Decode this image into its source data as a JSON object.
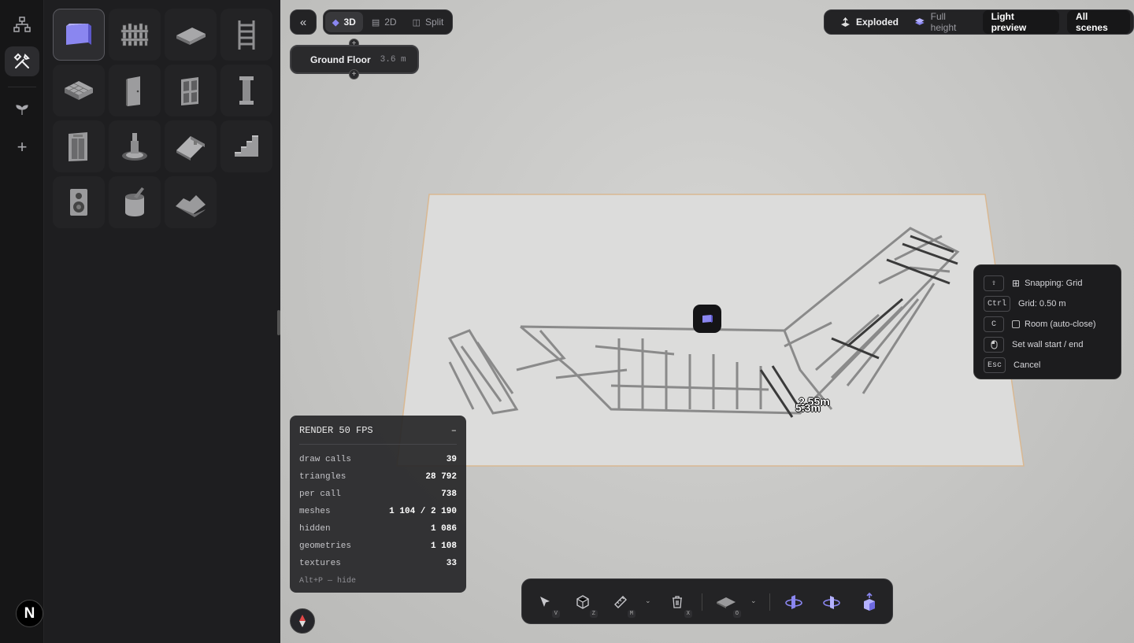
{
  "rail": {
    "items": [
      {
        "name": "hierarchy",
        "glyph": "⛙"
      },
      {
        "name": "build-tools",
        "glyph": "⚒"
      },
      {
        "name": "sprout",
        "glyph": "❦"
      },
      {
        "name": "add",
        "glyph": "+"
      }
    ],
    "logo": "N"
  },
  "catalog": {
    "items": [
      "Wall",
      "Fence",
      "Slab",
      "Ladder",
      "Ceiling",
      "Door",
      "Window",
      "Column",
      "Elevator",
      "Fountain",
      "Roof",
      "Stairs",
      "Speaker",
      "Paint",
      "Terrain"
    ]
  },
  "view": {
    "collapse_glyph": "«",
    "tabs": [
      {
        "label": "3D",
        "glyph": "◆"
      },
      {
        "label": "2D",
        "glyph": "▤"
      },
      {
        "label": "Split",
        "glyph": "◫"
      }
    ]
  },
  "floor": {
    "name": "Ground Floor",
    "height": "3.6 m"
  },
  "display": {
    "exploded_label": "Exploded",
    "full_height_label": "Full height",
    "light_preview_label": "Light preview",
    "all_scenes_label": "All scenes"
  },
  "shortcuts": [
    {
      "key": "⇧",
      "label": "Snapping: Grid",
      "icon": "grid"
    },
    {
      "key": "Ctrl",
      "label": "Grid: 0.50 m",
      "icon": ""
    },
    {
      "key": "C",
      "label": "Room (auto-close)",
      "icon": "checkbox"
    },
    {
      "key": "🖱",
      "label": "Set wall start / end",
      "icon": ""
    },
    {
      "key": "Esc",
      "label": "Cancel",
      "icon": ""
    }
  ],
  "stats": {
    "title": "RENDER 50 FPS",
    "collapse": "–",
    "rows": [
      {
        "k": "draw calls",
        "v": "39"
      },
      {
        "k": "triangles",
        "v": "28 792"
      },
      {
        "k": "per call",
        "v": "738"
      },
      {
        "k": "meshes",
        "v": "1 104 / 2 190"
      },
      {
        "k": "hidden",
        "v": "1 086"
      },
      {
        "k": "geometries",
        "v": "1 108"
      },
      {
        "k": "textures",
        "v": "33"
      }
    ],
    "footer": "Alt+P — hide"
  },
  "dimensions": {
    "a": "2.55m",
    "b": "5.3m"
  },
  "toolbar": {
    "select_key": "V",
    "box_key": "Z",
    "measure_key": "M",
    "delete_key": "X",
    "floor_key": "O"
  }
}
